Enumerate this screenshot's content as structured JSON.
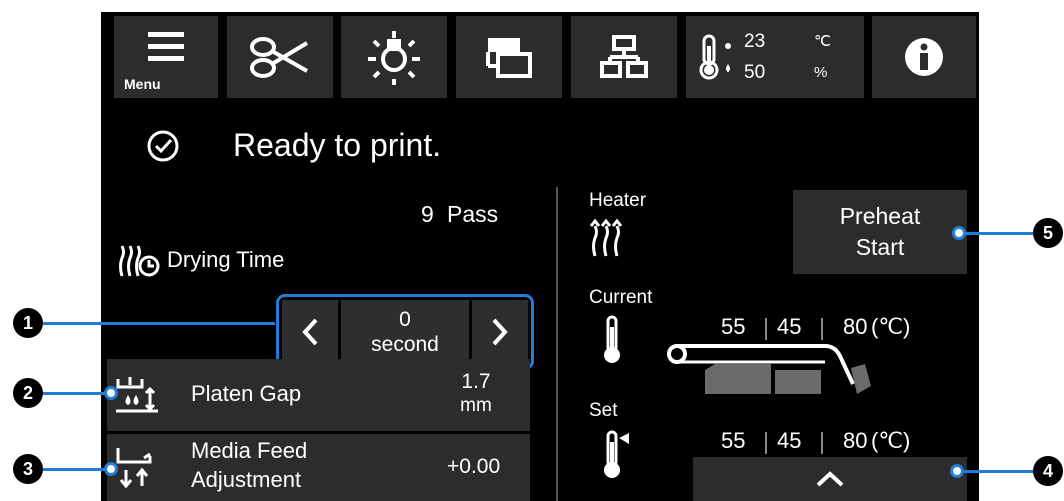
{
  "toolbar": {
    "menu_label": "Menu",
    "temperature_value": "23",
    "temperature_unit": "℃",
    "humidity_value": "50",
    "humidity_unit": "%"
  },
  "status": {
    "text": "Ready to print."
  },
  "print_settings": {
    "pass_value": "9",
    "pass_unit": "Pass",
    "drying_time_label": "Drying Time",
    "drying_value": "0",
    "drying_unit": "second",
    "platen_gap_label": "Platen Gap",
    "platen_gap_value": "1.7",
    "platen_gap_unit": "mm",
    "media_feed_label_line1": "Media Feed",
    "media_feed_label_line2": "Adjustment",
    "media_feed_value": "+0.00"
  },
  "heater": {
    "title": "Heater",
    "current_label": "Current",
    "set_label": "Set",
    "current_values": [
      "55",
      "45",
      "80"
    ],
    "set_values": [
      "55",
      "45",
      "80"
    ],
    "unit": "(℃)",
    "preheat_line1": "Preheat",
    "preheat_line2": "Start"
  },
  "callouts": [
    "1",
    "2",
    "3",
    "4",
    "5"
  ],
  "colors": {
    "screen_bg": "#000000",
    "button_bg": "#2c2c2c",
    "accent_blue": "#1f7fd6",
    "text": "#ffffff"
  }
}
